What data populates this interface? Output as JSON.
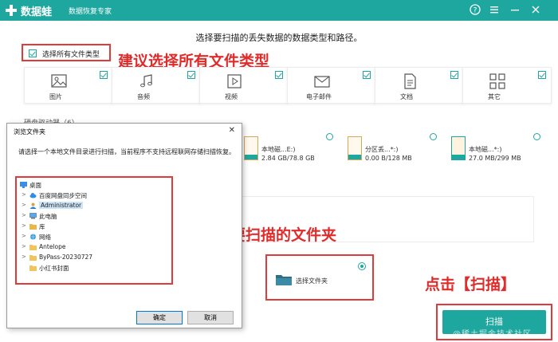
{
  "app": {
    "name": "数据蛙",
    "subtitle": "数据恢复专家",
    "controls": [
      "help-icon",
      "menu-icon",
      "minimize-icon",
      "close-icon"
    ],
    "accent": "#1ea79f"
  },
  "main": {
    "prompt": "选择要扫描的丢失数据的数据类型和路径。",
    "select_all_label": "选择所有文件类型",
    "file_types": [
      {
        "label": "图片",
        "icon": "image-icon"
      },
      {
        "label": "音频",
        "icon": "audio-icon"
      },
      {
        "label": "视频",
        "icon": "video-icon"
      },
      {
        "label": "电子邮件",
        "icon": "email-icon"
      },
      {
        "label": "文档",
        "icon": "document-icon"
      },
      {
        "label": "其它",
        "icon": "other-icon"
      }
    ],
    "drives_section": "硬盘驱动器（6）",
    "drives": [
      {
        "name": "本地磁...E:)",
        "size": "2.84 GB/78.8 GB"
      },
      {
        "name": "分区丢...*:)",
        "size": "0.00  B/128 MB"
      },
      {
        "name": "本地磁...*:)",
        "size": "27.0 MB/299 MB"
      }
    ],
    "choose_folder_label": "选择文件夹",
    "scan_label": "扫描",
    "watermark": "@稀土掘金技术社区"
  },
  "annotations": {
    "select_all_tip": "建议选择所有文件类型",
    "folder_tip": "选择需要扫描的文件夹",
    "scan_tip": "点击【扫描】",
    "color": "#e02b2b"
  },
  "dialog": {
    "title": "浏览文件夹",
    "description": "请选择一个本地文件目录进行扫描，当前程序不支持远程联网存储扫描恢复。",
    "tree": [
      {
        "label": "桌面",
        "icon": "desktop-icon",
        "arrow": ""
      },
      {
        "label": "百度网盘同步空间",
        "icon": "cloud-icon",
        "arrow": ">"
      },
      {
        "label": "Administrator",
        "icon": "user-icon",
        "arrow": ">",
        "selected": true
      },
      {
        "label": "此电脑",
        "icon": "computer-icon",
        "arrow": ">"
      },
      {
        "label": "库",
        "icon": "library-icon",
        "arrow": ">"
      },
      {
        "label": "网络",
        "icon": "network-icon",
        "arrow": ">"
      },
      {
        "label": "Antelope",
        "icon": "folder-icon",
        "arrow": ">"
      },
      {
        "label": "ByPass-20230727",
        "icon": "folder-icon",
        "arrow": ">"
      },
      {
        "label": "小红书封面",
        "icon": "folder-icon",
        "arrow": ""
      }
    ],
    "ok_label": "确定",
    "cancel_label": "取消"
  }
}
